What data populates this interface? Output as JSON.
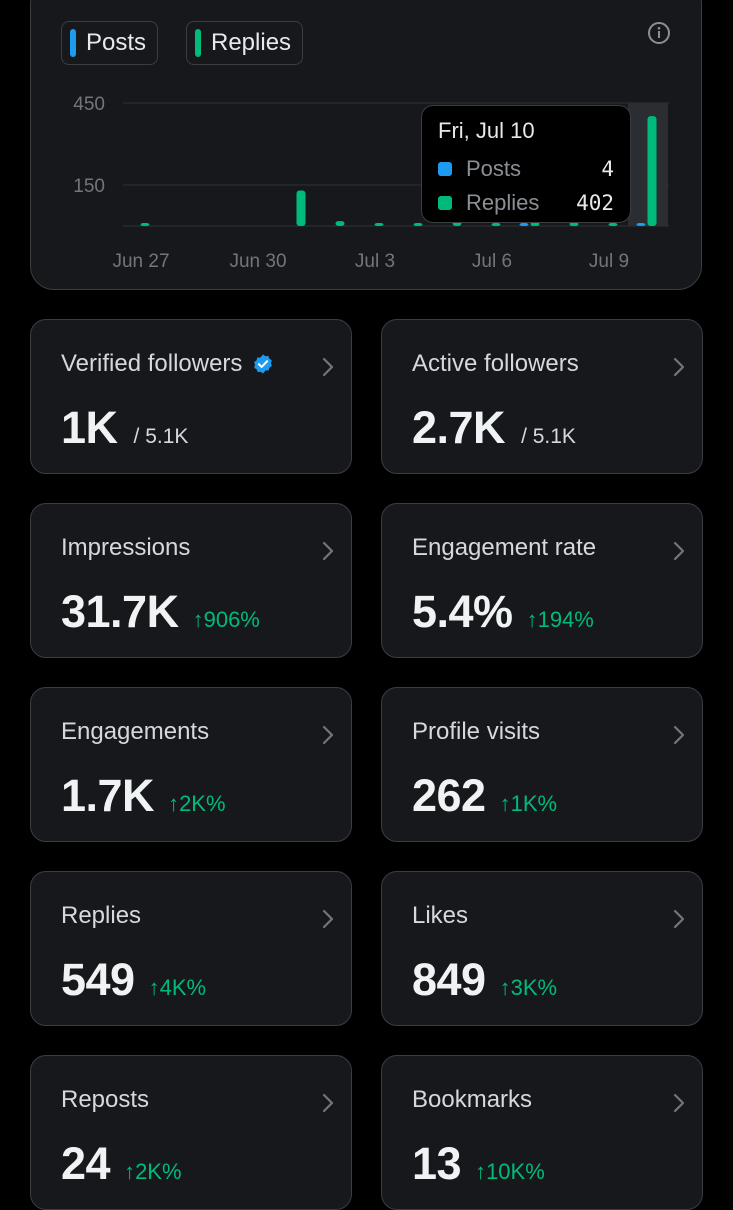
{
  "legend": {
    "posts_label": "Posts",
    "replies_label": "Replies",
    "posts_color": "#1d9bf0",
    "replies_color": "#00ba7c"
  },
  "info_icon": "info-icon",
  "chart_data": {
    "type": "bar",
    "x": [
      "Jun 27",
      "Jun 28",
      "Jun 29",
      "Jun 30",
      "Jul 1",
      "Jul 2",
      "Jul 3",
      "Jul 4",
      "Jul 5",
      "Jul 6",
      "Jul 7",
      "Jul 8",
      "Jul 9",
      "Jul 10"
    ],
    "x_tick_labels": [
      "Jun 27",
      "Jun 30",
      "Jul 3",
      "Jul 6",
      "Jul 9"
    ],
    "y_tick_labels": [
      "150",
      "450"
    ],
    "series": [
      {
        "name": "Posts",
        "color": "#1d9bf0",
        "values": [
          0,
          0,
          0,
          0,
          0,
          0,
          0,
          0,
          0,
          0,
          4,
          0,
          0,
          4
        ]
      },
      {
        "name": "Replies",
        "color": "#00ba7c",
        "values": [
          2,
          0,
          0,
          0,
          130,
          18,
          8,
          8,
          40,
          4,
          14,
          14,
          6,
          402
        ]
      }
    ],
    "ylim": [
      0,
      450
    ],
    "grid": true,
    "highlighted": "Jul 10",
    "tooltip": {
      "title": "Fri, Jul 10",
      "rows": [
        {
          "name": "Posts",
          "value": "4",
          "color": "#1d9bf0"
        },
        {
          "name": "Replies",
          "value": "402",
          "color": "#00ba7c"
        }
      ]
    }
  },
  "cards": [
    {
      "label": "Verified followers",
      "value": "1K",
      "sub": "/ 5.1K",
      "verified": true
    },
    {
      "label": "Active followers",
      "value": "2.7K",
      "sub": "/ 5.1K"
    },
    {
      "label": "Impressions",
      "value": "31.7K",
      "delta": "↑906%"
    },
    {
      "label": "Engagement rate",
      "value": "5.4%",
      "delta": "↑194%"
    },
    {
      "label": "Engagements",
      "value": "1.7K",
      "delta": "↑2K%"
    },
    {
      "label": "Profile visits",
      "value": "262",
      "delta": "↑1K%"
    },
    {
      "label": "Replies",
      "value": "549",
      "delta": "↑4K%"
    },
    {
      "label": "Likes",
      "value": "849",
      "delta": "↑3K%"
    },
    {
      "label": "Reposts",
      "value": "24",
      "delta": "↑2K%"
    },
    {
      "label": "Bookmarks",
      "value": "13",
      "delta": "↑10K%"
    }
  ]
}
